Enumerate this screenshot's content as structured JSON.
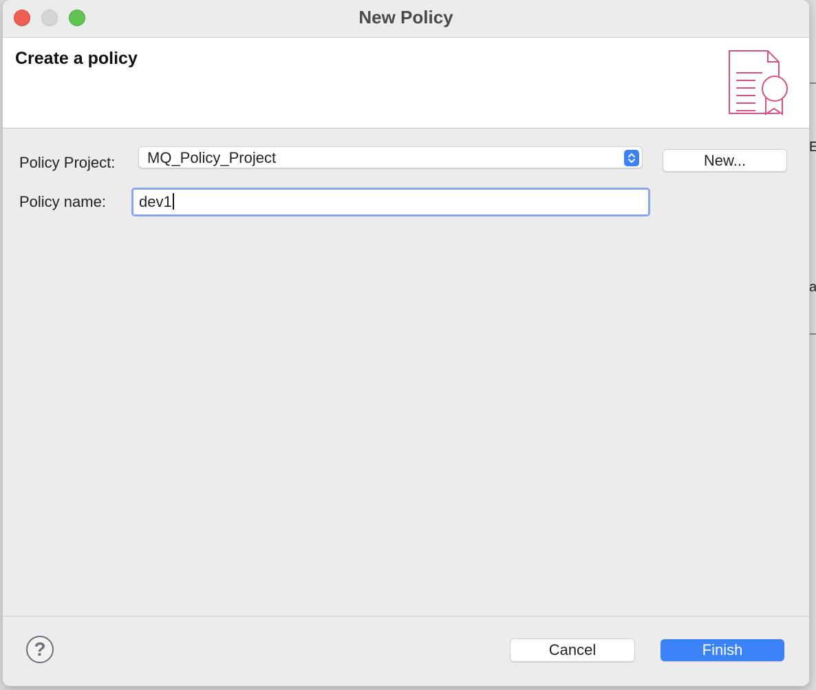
{
  "window": {
    "title": "New Policy"
  },
  "header": {
    "title": "Create a policy"
  },
  "form": {
    "project_label": "Policy Project:",
    "project_value": "MQ_Policy_Project",
    "new_button": "New...",
    "name_label": "Policy name:",
    "name_value": "dev1"
  },
  "footer": {
    "help_glyph": "?",
    "cancel_label": "Cancel",
    "finish_label": "Finish"
  },
  "background_fragments": [
    "E",
    "a"
  ],
  "colors": {
    "accent": "#3b82f6",
    "icon_pink": "#d9527f",
    "traffic_close": "#ee5e55",
    "traffic_max": "#5fc454"
  }
}
